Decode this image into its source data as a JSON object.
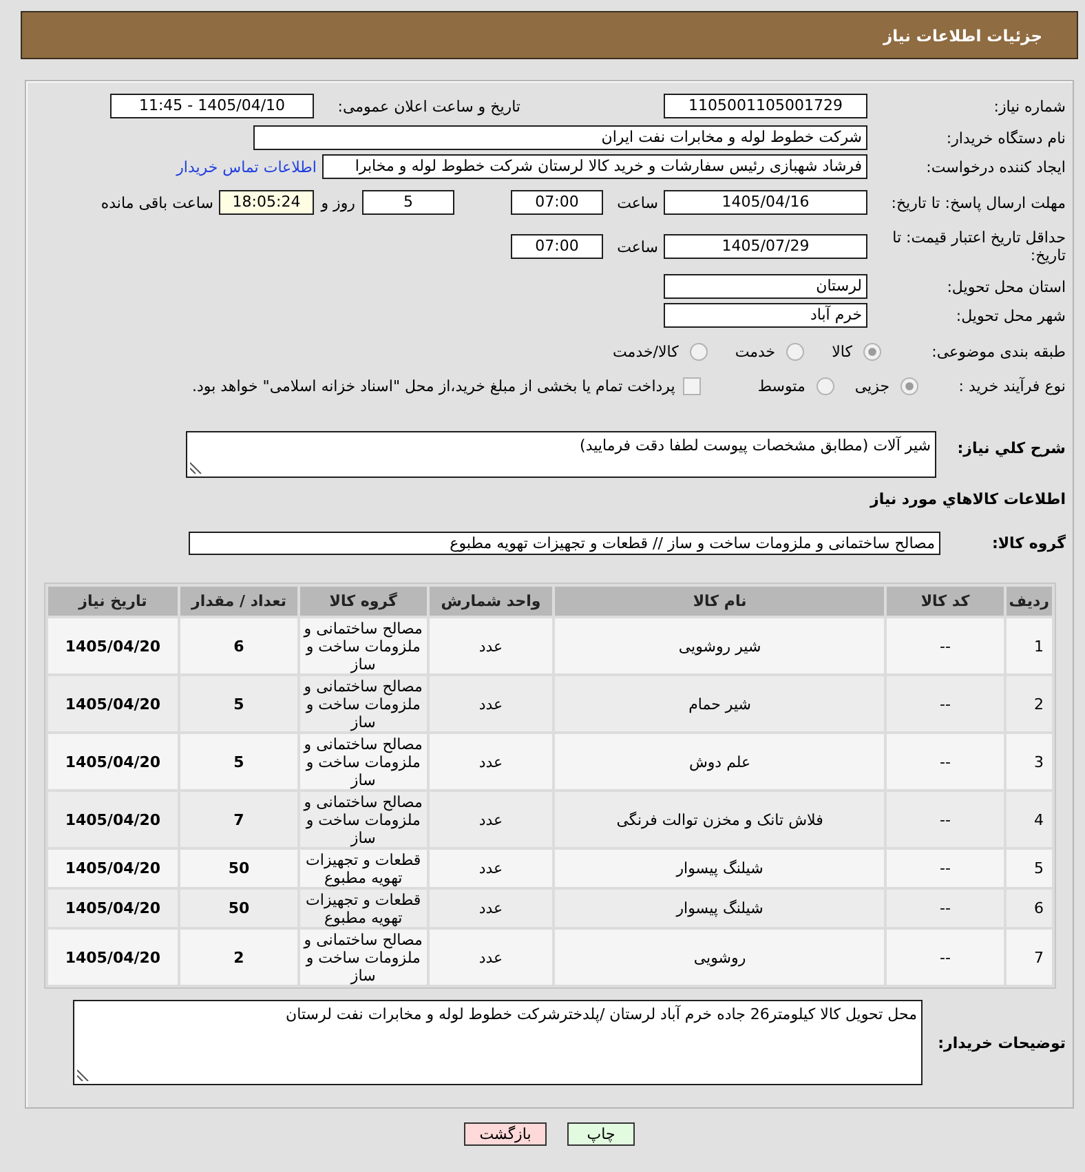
{
  "header": {
    "title": "جزئیات اطلاعات نیاز"
  },
  "form": {
    "need_number": {
      "label": "شماره نیاز:",
      "value": "1105001105001729"
    },
    "announcement": {
      "label": "تاریخ و ساعت اعلان عمومی:",
      "value": "1405/04/10 - 11:45"
    },
    "buyer_org": {
      "label": "نام دستگاه خریدار:",
      "value": "شرکت خطوط لوله و مخابرات نفت ایران"
    },
    "requester": {
      "label": "ایجاد کننده درخواست:",
      "value": "فرشاد شهبازی رئیس سفارشات و خرید کالا لرستان شرکت خطوط لوله و مخابرا",
      "contact_link": "اطلاعات تماس خریدار"
    },
    "reply_deadline": {
      "label": "مهلت ارسال پاسخ: تا تاریخ:",
      "date": "1405/04/16",
      "time_label": "ساعت",
      "time": "07:00",
      "days": "5",
      "days_label": "روز و",
      "remaining": "18:05:24",
      "remaining_label": "ساعت باقی مانده"
    },
    "price_validity": {
      "label": "حداقل تاریخ اعتبار قیمت: تا تاریخ:",
      "date": "1405/07/29",
      "time_label": "ساعت",
      "time": "07:00"
    },
    "province": {
      "label": "استان محل تحویل:",
      "value": "لرستان"
    },
    "city": {
      "label": "شهر محل تحویل:",
      "value": "خرم آباد"
    },
    "category": {
      "label": "طبقه بندی موضوعی:",
      "options": [
        {
          "label": "کالا",
          "selected": true
        },
        {
          "label": "خدمت",
          "selected": false
        },
        {
          "label": "کالا/خدمت",
          "selected": false
        }
      ]
    },
    "purchase_process": {
      "label": "نوع فرآیند خرید :",
      "options": [
        {
          "label": "جزیی",
          "selected": true
        },
        {
          "label": "متوسط",
          "selected": false
        }
      ],
      "treasury_payment": {
        "label": "پرداخت تمام یا بخشی از مبلغ خرید،از محل \"اسناد خزانه اسلامی\" خواهد بود.",
        "checked": false
      }
    }
  },
  "description": {
    "label": "شرح کلي نياز:",
    "value": "شیر آلات (مطابق مشخصات پیوست لطفا دقت فرمایید)"
  },
  "goods": {
    "title": "اطلاعات کالاهاي مورد نياز",
    "group_label": "گروه کالا:",
    "group_value": "مصالح ساختمانی و ملزومات ساخت و ساز // قطعات و تجهیزات تهویه مطبوع"
  },
  "table": {
    "columns": [
      "ردیف",
      "کد کالا",
      "نام کالا",
      "واحد شمارش",
      "گروه کالا",
      "تعداد / مقدار",
      "تاریخ نیاز"
    ],
    "rows": [
      {
        "row": "1",
        "code": "--",
        "name": "شیر روشویی",
        "unit": "عدد",
        "group": "مصالح ساختمانی و ملزومات ساخت و ساز",
        "quantity": "6",
        "date": "1405/04/20"
      },
      {
        "row": "2",
        "code": "--",
        "name": "شیر حمام",
        "unit": "عدد",
        "group": "مصالح ساختمانی و ملزومات ساخت و ساز",
        "quantity": "5",
        "date": "1405/04/20"
      },
      {
        "row": "3",
        "code": "--",
        "name": "علم دوش",
        "unit": "عدد",
        "group": "مصالح ساختمانی و ملزومات ساخت و ساز",
        "quantity": "5",
        "date": "1405/04/20"
      },
      {
        "row": "4",
        "code": "--",
        "name": "فلاش تانک و مخزن توالت فرنگی",
        "unit": "عدد",
        "group": "مصالح ساختمانی و ملزومات ساخت و ساز",
        "quantity": "7",
        "date": "1405/04/20"
      },
      {
        "row": "5",
        "code": "--",
        "name": "شیلنگ پیسوار",
        "unit": "عدد",
        "group": "قطعات و تجهیزات تهویه مطبوع",
        "quantity": "50",
        "date": "1405/04/20"
      },
      {
        "row": "6",
        "code": "--",
        "name": "شیلنگ پیسوار",
        "unit": "عدد",
        "group": "قطعات و تجهیزات تهویه مطبوع",
        "quantity": "50",
        "date": "1405/04/20"
      },
      {
        "row": "7",
        "code": "--",
        "name": "روشویی",
        "unit": "عدد",
        "group": "مصالح ساختمانی و ملزومات ساخت و ساز",
        "quantity": "2",
        "date": "1405/04/20"
      }
    ]
  },
  "buyer_notes": {
    "label": "توضیحات خریدار:",
    "value": "محل تحویل کالا کیلومتر26 جاده خرم آباد لرستان /پلدخترشرکت خطوط لوله و مخابرات نفت لرستان"
  },
  "buttons": [
    {
      "label": "چاپ",
      "kind": "print"
    },
    {
      "label": "بازگشت",
      "kind": "back"
    }
  ]
}
